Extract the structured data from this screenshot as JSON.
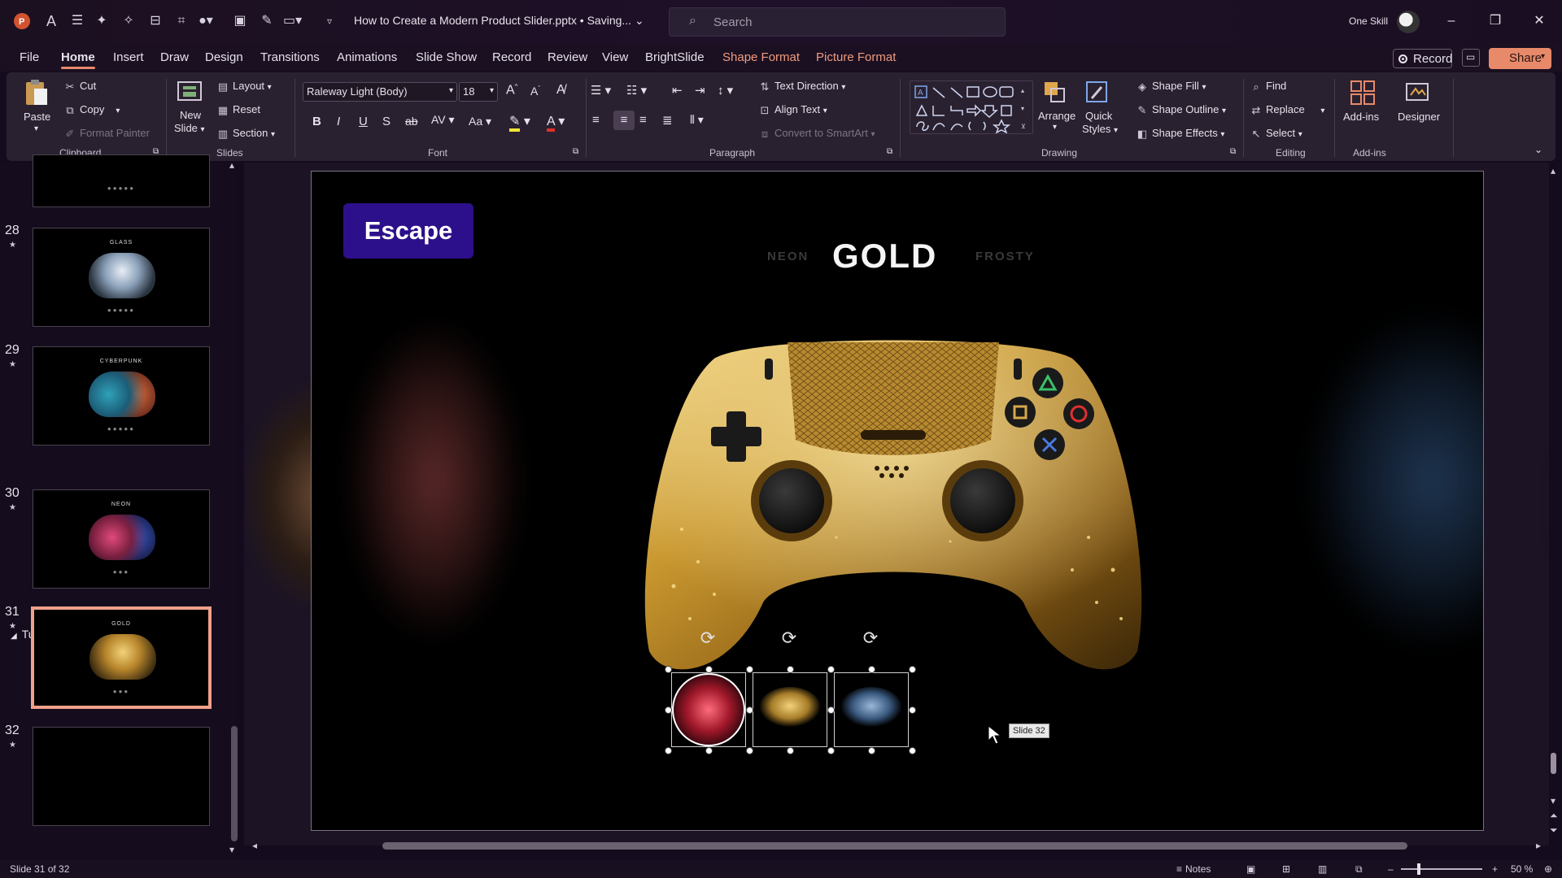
{
  "titlebar": {
    "doc_title": "How to Create a Modern Product Slider.pptx • Saving...",
    "search_placeholder": "Search",
    "user_name": "One Skill"
  },
  "tabs": [
    {
      "label": "File",
      "active": false
    },
    {
      "label": "Home",
      "active": true
    },
    {
      "label": "Insert",
      "active": false
    },
    {
      "label": "Draw",
      "active": false
    },
    {
      "label": "Design",
      "active": false
    },
    {
      "label": "Transitions",
      "active": false
    },
    {
      "label": "Animations",
      "active": false
    },
    {
      "label": "Slide Show",
      "active": false
    },
    {
      "label": "Record",
      "active": false
    },
    {
      "label": "Review",
      "active": false
    },
    {
      "label": "View",
      "active": false
    },
    {
      "label": "BrightSlide",
      "active": false
    },
    {
      "label": "Shape Format",
      "contextual": true
    },
    {
      "label": "Picture Format",
      "contextual": true
    }
  ],
  "tab_actions": {
    "record": "Record",
    "share": "Share"
  },
  "ribbon": {
    "clipboard": {
      "paste": "Paste",
      "cut": "Cut",
      "copy": "Copy",
      "format_painter": "Format Painter",
      "label": "Clipboard"
    },
    "slides": {
      "new_slide": "New",
      "new_slide2": "Slide",
      "layout": "Layout",
      "reset": "Reset",
      "section": "Section",
      "label": "Slides"
    },
    "font": {
      "family": "Raleway Light (Body)",
      "size": "18",
      "label": "Font"
    },
    "paragraph": {
      "text_direction": "Text Direction",
      "align_text": "Align Text",
      "convert_smartart": "Convert to SmartArt",
      "label": "Paragraph"
    },
    "drawing": {
      "arrange": "Arrange",
      "quick_styles": "Quick",
      "quick_styles2": "Styles",
      "shape_fill": "Shape Fill",
      "shape_outline": "Shape Outline",
      "shape_effects": "Shape Effects",
      "label": "Drawing"
    },
    "editing": {
      "find": "Find",
      "replace": "Replace",
      "select": "Select",
      "label": "Editing"
    },
    "addins": {
      "addins": "Add-ins",
      "designer": "Designer",
      "label": "Add-ins"
    }
  },
  "thumbnails": {
    "section": "Tutorial",
    "items": [
      {
        "num": "28",
        "title": "GLASS",
        "selected": false
      },
      {
        "num": "29",
        "title": "CYBERPUNK",
        "selected": false
      },
      {
        "num": "30",
        "title": "NEON",
        "selected": false
      },
      {
        "num": "31",
        "title": "GOLD",
        "selected": true
      },
      {
        "num": "32",
        "title": "",
        "selected": false
      }
    ]
  },
  "slide": {
    "escape": "Escape",
    "nav_left": "NEON",
    "nav_center": "GOLD",
    "nav_right": "FROSTY",
    "tooltip": "Slide 32"
  },
  "statusbar": {
    "slide_info": "Slide 31 of 32",
    "notes": "Notes",
    "zoom": "50 %"
  },
  "colors": {
    "accent": "#e8896a",
    "escape_badge": "#2c0f8a",
    "gold": "#c9a24a"
  }
}
